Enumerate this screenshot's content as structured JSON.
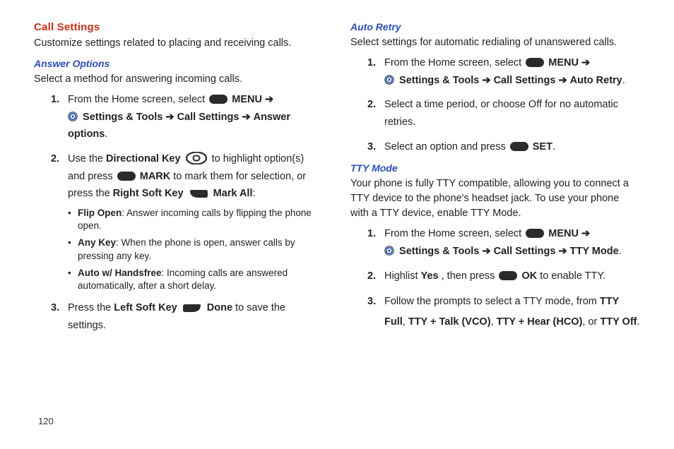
{
  "page_number": "120",
  "left": {
    "title_red": "Call Settings",
    "intro1": "Customize settings related to placing and receiving calls.",
    "sub_blue": "Answer Options",
    "intro2": "Select a method for answering incoming calls.",
    "step1_a": "From the Home screen, select ",
    "step1_b": " MENU ",
    "step1_c": " Settings & Tools ",
    "step1_d": " Call Settings ",
    "step1_e": " Answer options",
    "step2_a": "Use the ",
    "step2_b": "Directional Key",
    "step2_c": " to highlight option(s) and press ",
    "step2_d": " MARK",
    "step2_e": " to mark them for selection, or press the ",
    "step2_f": "Right Soft Key",
    "step2_g": " Mark All",
    "opt1_b": "Flip Open",
    "opt1_t": ": Answer incoming calls by flipping the phone open.",
    "opt2_b": "Any Key",
    "opt2_t": ": When the phone is open, answer calls by pressing any key.",
    "opt3_b": "Auto w/ Handsfree",
    "opt3_t": ": Incoming calls are answered automatically, after a short delay.",
    "step3_a": "Press the ",
    "step3_b": "Left Soft Key",
    "step3_c": " Done",
    "step3_d": " to save the settings."
  },
  "right": {
    "sub_blue1": "Auto Retry",
    "intro1": "Select settings for automatic redialing of unanswered calls.",
    "ar1_a": "From the Home screen, select ",
    "ar1_b": " MENU ",
    "ar1_c": " Settings & Tools ",
    "ar1_d": " Call Settings ",
    "ar1_e": " Auto Retry",
    "ar2": "Select a time period, or choose Off for no automatic retries.",
    "ar3_a": "Select an option and press ",
    "ar3_b": " SET",
    "sub_blue2": "TTY Mode",
    "intro2": "Your phone is fully TTY compatible, allowing you to connect a TTY device to the phone's headset jack. To use your phone with a TTY device, enable TTY Mode.",
    "tt1_a": "From the Home screen, select ",
    "tt1_b": " MENU ",
    "tt1_c": " Settings & Tools ",
    "tt1_d": " Call Settings ",
    "tt1_e": " TTY Mode",
    "tt2_a": "Highlist ",
    "tt2_b": "Yes",
    "tt2_c": ", then press ",
    "tt2_d": " OK",
    "tt2_e": " to enable TTY.",
    "tt3_a": "Follow the prompts to select a TTY mode, from ",
    "tt3_b": "TTY Full",
    "tt3_c": ", ",
    "tt3_d": "TTY + Talk (VCO)",
    "tt3_e": ", ",
    "tt3_f": "TTY + Hear (HCO)",
    "tt3_g": ", or ",
    "tt3_h": "TTY Off",
    "tt3_i": "."
  }
}
